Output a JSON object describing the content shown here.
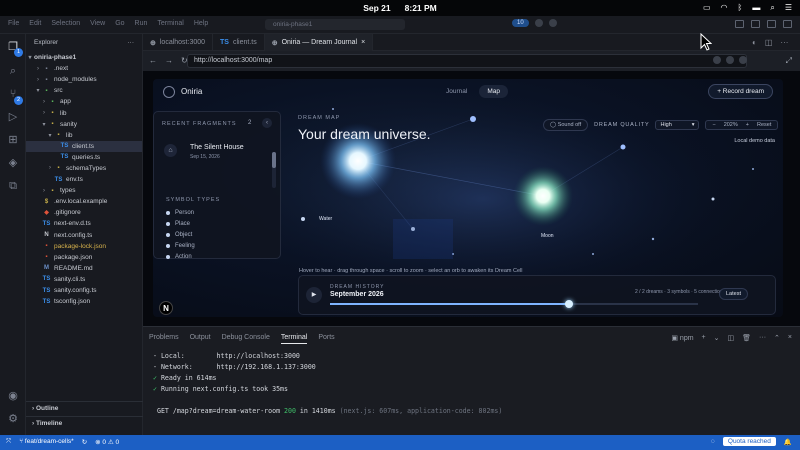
{
  "menubar": {
    "date": "Sep 21",
    "time": "8:21 PM"
  },
  "titlebar": {
    "menus": [
      "File",
      "Edit",
      "Selection",
      "View",
      "Go",
      "Run",
      "Terminal",
      "Help"
    ],
    "command_center": "oniria-phase1",
    "count_badge": "10"
  },
  "explorer": {
    "title": "Explorer",
    "project": "oniria-phase1",
    "tree": [
      {
        "label": ".next",
        "depth": 1,
        "kind": "folder",
        "open": false,
        "icon_color": "#7b8394"
      },
      {
        "label": "node_modules",
        "depth": 1,
        "kind": "folder",
        "open": false,
        "icon_color": "#7b8394"
      },
      {
        "label": "src",
        "depth": 1,
        "kind": "folder",
        "open": true,
        "icon_color": "#5cb85c"
      },
      {
        "label": "app",
        "depth": 2,
        "kind": "folder",
        "open": false,
        "icon_color": "#5cb85c"
      },
      {
        "label": "lib",
        "depth": 2,
        "kind": "folder",
        "open": false,
        "icon_color": "#c8b04a"
      },
      {
        "label": "sanity",
        "depth": 2,
        "kind": "folder",
        "open": true,
        "icon_color": "#c8b04a"
      },
      {
        "label": "lib",
        "depth": 3,
        "kind": "folder",
        "open": true,
        "icon_color": "#c8b04a"
      },
      {
        "label": "client.ts",
        "depth": 4,
        "kind": "ts",
        "selected": true,
        "icon_color": "#3b8eea"
      },
      {
        "label": "queries.ts",
        "depth": 4,
        "kind": "ts",
        "icon_color": "#3b8eea"
      },
      {
        "label": "schemaTypes",
        "depth": 3,
        "kind": "folder",
        "open": false,
        "icon_color": "#c8b04a"
      },
      {
        "label": "env.ts",
        "depth": 3,
        "kind": "ts",
        "icon_color": "#3b8eea"
      },
      {
        "label": "types",
        "depth": 2,
        "kind": "folder",
        "open": false,
        "icon_color": "#c8b04a"
      },
      {
        "label": ".env.local.example",
        "depth": 1,
        "kind": "env",
        "icon_color": "#c8b04a"
      },
      {
        "label": ".gitignore",
        "depth": 1,
        "kind": "git",
        "icon_color": "#e0533a"
      },
      {
        "label": "next-env.d.ts",
        "depth": 1,
        "kind": "ts",
        "icon_color": "#3b8eea"
      },
      {
        "label": "next.config.ts",
        "depth": 1,
        "kind": "next",
        "icon_color": "#c7cad1"
      },
      {
        "label": "package-lock.json",
        "depth": 1,
        "kind": "npm",
        "icon_color": "#e0533a",
        "highlight": "#d7b24c"
      },
      {
        "label": "package.json",
        "depth": 1,
        "kind": "npm",
        "icon_color": "#e0533a"
      },
      {
        "label": "README.md",
        "depth": 1,
        "kind": "md",
        "icon_color": "#6b8fc7"
      },
      {
        "label": "sanity.cli.ts",
        "depth": 1,
        "kind": "ts",
        "icon_color": "#3b8eea"
      },
      {
        "label": "sanity.config.ts",
        "depth": 1,
        "kind": "ts",
        "icon_color": "#3b8eea"
      },
      {
        "label": "tsconfig.json",
        "depth": 1,
        "kind": "ts",
        "icon_color": "#3b8eea"
      }
    ],
    "outline": "Outline",
    "timeline": "Timeline"
  },
  "tabs": [
    {
      "label": "localhost:3000",
      "icon": "globe-icon",
      "active": false
    },
    {
      "label": "client.ts",
      "icon": "ts-icon",
      "active": false
    },
    {
      "label": "Oniria — Dream Journal",
      "icon": "globe-icon",
      "active": true
    }
  ],
  "browser": {
    "url": "http://localhost:3000/map"
  },
  "app": {
    "brand": "Oniria",
    "nav": [
      "Journal",
      "Map"
    ],
    "nav_active": "Map",
    "record_button": "+ Record dream",
    "fragments": {
      "title": "RECENT FRAGMENTS",
      "count": "2",
      "card_title": "The Silent House",
      "card_date": "Sep 15, 2026",
      "symbol_types_title": "SYMBOL TYPES",
      "symbol_types": [
        "Person",
        "Place",
        "Object",
        "Feeling",
        "Action"
      ]
    },
    "map": {
      "label": "DREAM MAP",
      "title": "Your dream universe.",
      "sound": "Sound off",
      "quality_label": "DREAM QUALITY",
      "quality_value": "High",
      "zoom_minus": "−",
      "zoom_value": "202%",
      "zoom_plus": "+",
      "reset": "Reset",
      "local_demo": "Local demo data",
      "hint": "Hover to hear · drag through space · scroll to zoom · select an orb to awaken its Dream Cell",
      "orb_labels": [
        "Water",
        "Moon"
      ]
    },
    "history": {
      "label": "DREAM HISTORY",
      "month": "September 2026",
      "stats": "2 / 2 dreams · 3 symbols · 5 connections",
      "latest": "Latest",
      "progress": 0.65
    }
  },
  "panel": {
    "tabs": [
      "Problems",
      "Output",
      "Debug Console",
      "Terminal",
      "Ports"
    ],
    "active_tab": "Terminal",
    "shell": "npm",
    "lines": [
      {
        "prefix": "- ",
        "text": "Local:        http://localhost:3000"
      },
      {
        "prefix": "- ",
        "text": "Network:      http://192.168.1.137:3000"
      },
      {
        "prefix": "✓ ",
        "text": "Ready in 614ms",
        "ok": true
      },
      {
        "prefix": "✓ ",
        "text": "Running next.config.ts took 35ms",
        "ok": true
      },
      {
        "prefix": "",
        "text": ""
      },
      {
        "prefix": " GET ",
        "text": "/map?dream=dream-water-room ",
        "status": "200",
        "after": " in 1410ms ",
        "dim": "(next.js: 607ms, application-code: 802ms)"
      }
    ]
  },
  "statusbar": {
    "branch": "feat/dream-cells*",
    "errors": "0",
    "warnings": "0",
    "quota": "Quota reached"
  }
}
